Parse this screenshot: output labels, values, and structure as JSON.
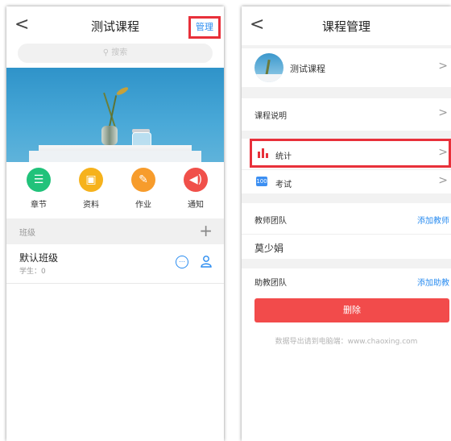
{
  "left": {
    "title": "测试课程",
    "back": "<",
    "manage_label": "管理",
    "search_placeholder": "搜索",
    "icons": [
      {
        "label": "章节",
        "icon": "list-icon",
        "color": "#21c27a"
      },
      {
        "label": "资料",
        "icon": "document-icon",
        "color": "#f6b21c"
      },
      {
        "label": "作业",
        "icon": "edit-icon",
        "color": "#f79c2c"
      },
      {
        "label": "通知",
        "icon": "speaker-icon",
        "color": "#f0504a"
      }
    ],
    "section_label": "班级",
    "class_name": "默认班级",
    "class_sub": "学生：0"
  },
  "right": {
    "title": "课程管理",
    "back": "<",
    "course_name": "测试课程",
    "description_label": "课程说明",
    "stats_label": "统计",
    "exam_label": "考试",
    "teacher_team_label": "教师团队",
    "add_teacher": "添加教师",
    "teacher_name": "莫少娟",
    "assistant_team_label": "助教团队",
    "add_assistant": "添加助教",
    "delete_label": "删除",
    "footnote": "数据导出请到电脑端：www.chaoxing.com"
  },
  "colors": {
    "accent": "#2a8cf0",
    "highlight": "#e8303a",
    "delete": "#f24b4b"
  }
}
